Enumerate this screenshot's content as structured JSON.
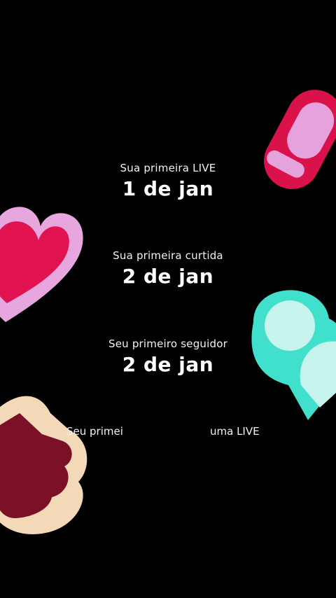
{
  "milestones": [
    {
      "label": "Sua primeira LIVE",
      "date": "1 de jan"
    },
    {
      "label": "Sua primeira curtida",
      "date": "2 de jan"
    },
    {
      "label": "Seu primeiro seguidor",
      "date": "2 de jan"
    }
  ],
  "partial_text": {
    "left": "Seu primei",
    "right": "uma LIVE"
  },
  "colors": {
    "background": "#000000",
    "heart_fill": "#e0124f",
    "heart_outline": "#e8a6de",
    "mic_outline": "#d9124a",
    "mic_fill": "#e6a2dc",
    "person_outline": "#40e0cc",
    "person_fill": "#c8f4ee",
    "hand_outline": "#f3d9b8",
    "hand_fill": "#7a1126"
  },
  "icons": [
    "microphone-sticker-icon",
    "heart-sticker-icon",
    "follower-sticker-icon",
    "hand-sticker-icon"
  ]
}
